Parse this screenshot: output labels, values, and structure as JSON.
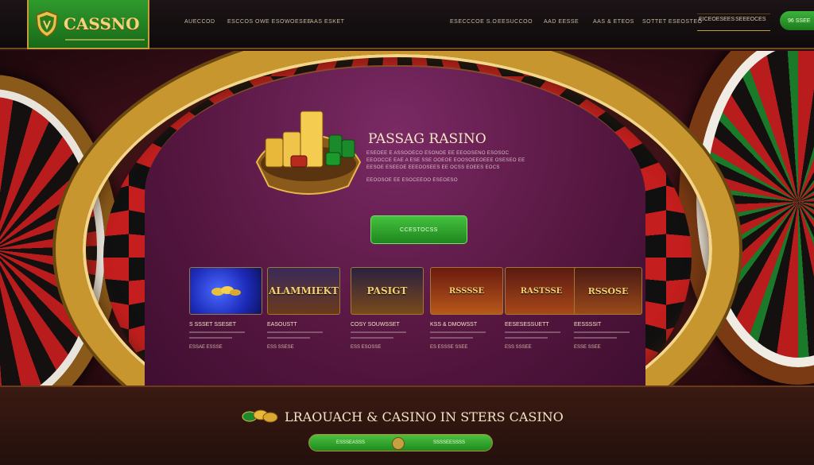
{
  "header": {
    "logo_text": "CASSNO",
    "nav": [
      "AUECCOD",
      "ESCCOS OWE ESOWOESEE",
      "AAS ESKET",
      "ESECCCOE S.O",
      "EESUCCOO",
      "AAD EESSE",
      "AAS & ETEOS",
      "SOTTET ESEOSTEO"
    ],
    "special_links": [
      "EICEOESEES",
      "SEEEOCES"
    ],
    "cta_label": "96 SSEE"
  },
  "hero": {
    "title": "PASSAG RASINO",
    "lines": [
      "ESEOEE E ASSOOECO ESONOE EE EEOOSENO ESOSOC",
      "EEOOCCE EAE A ESE SSE OOEOE EOOSOEEOEEE OSESEO EE",
      "EESOE ESEEOE EEEOOSEES EE OCSS EOEES EOCS",
      "EEOOSOE EE ESOCEEOO ESEOESO"
    ],
    "cta_label": "CCESTOCSS"
  },
  "cards": [
    {
      "thumb": "",
      "title": "S SSSET SSESET",
      "link": "ESSAE ESSSE"
    },
    {
      "thumb": "ALAMMIEKT",
      "title": "EASOUSTT",
      "link": "ESS SSESE"
    },
    {
      "thumb": "PASIGT",
      "title": "COSY SOUWSSET",
      "link": "ESS ESOSSE"
    },
    {
      "thumb": "RSSSSE",
      "title": "KSS & DMOWSST",
      "link": "ES ESSSE SSEE"
    },
    {
      "thumb": "RASTSSE",
      "title": "EESESESSUETT",
      "link": "ESS SSSEE"
    },
    {
      "thumb": "RSSOSE",
      "title": "EESSSSIT",
      "link": "ESSE SSEE"
    }
  ],
  "bottom": {
    "title": "LRAOUACH & CASINO IN STERS CASINO",
    "btn_left": "ESSSEASSS",
    "btn_right": "SSSSEESSSS"
  },
  "colors": {
    "accent_green": "#2f9a2c",
    "gold": "#c8962e",
    "felt_purple": "#55163f",
    "roulette_red": "#c41e1e"
  },
  "icons": [
    "shield-logo-icon",
    "casino-chips-icon",
    "coin-icon"
  ]
}
